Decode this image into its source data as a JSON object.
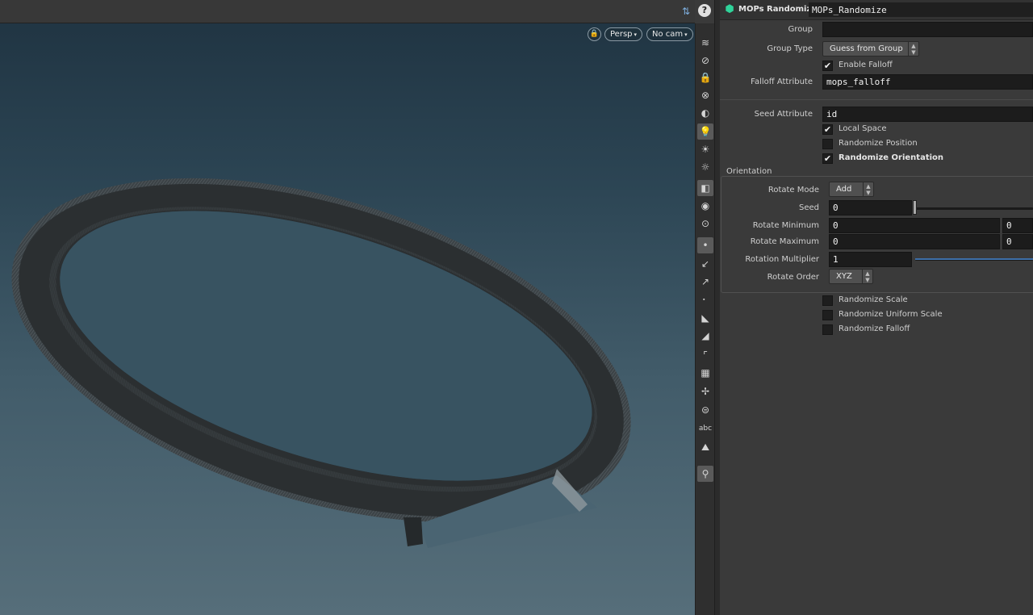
{
  "viewport": {
    "camera_view": "Persp",
    "camera": "No cam",
    "lock_icon": "lock-icon",
    "help_icon": "help-icon",
    "view_options_icon": "display-options-icon"
  },
  "toolbar": {
    "items": [
      {
        "name": "ghost-display-icon",
        "glyph": "≋",
        "on": false
      },
      {
        "name": "template-icon",
        "glyph": "⊘",
        "on": false
      },
      {
        "name": "lock-camera-icon",
        "glyph": "🔒",
        "on": false
      },
      {
        "name": "snap-off-icon",
        "glyph": "⊗",
        "on": false
      },
      {
        "name": "shading-icon",
        "glyph": "◐",
        "on": false
      },
      {
        "name": "light-icon",
        "glyph": "💡",
        "on": true
      },
      {
        "name": "light-bulb-small-icon",
        "glyph": "☀",
        "on": false
      },
      {
        "name": "light-bulb-alt-icon",
        "glyph": "☼",
        "on": false
      },
      {
        "name": "display-mode-icon",
        "glyph": "◧",
        "on": true
      },
      {
        "name": "visibility-icon",
        "glyph": "◉",
        "on": false
      },
      {
        "name": "camera-eye-icon",
        "glyph": "⊙",
        "on": false
      },
      {
        "name": "point-display-icon",
        "glyph": "•",
        "on": true
      },
      {
        "name": "normals-icon",
        "glyph": "↙",
        "on": false
      },
      {
        "name": "point-normals-icon",
        "glyph": "↗",
        "on": false
      },
      {
        "name": "point-numbers-icon",
        "glyph": "⠂",
        "on": false
      },
      {
        "name": "prim-normals-icon",
        "glyph": "◣",
        "on": false
      },
      {
        "name": "prim-numbers-icon",
        "glyph": "◢",
        "on": false
      },
      {
        "name": "edge-display-icon",
        "glyph": "⌜",
        "on": false
      },
      {
        "name": "uv-display-icon",
        "glyph": "▦",
        "on": false
      },
      {
        "name": "vector-display-icon",
        "glyph": "✢",
        "on": false
      },
      {
        "name": "hull-display-icon",
        "glyph": "⊜",
        "on": false
      },
      {
        "name": "text-display-icon",
        "glyph": "abc",
        "on": false
      },
      {
        "name": "background-image-icon",
        "glyph": "⛰",
        "on": false
      },
      {
        "name": "handle-display-icon",
        "glyph": "⚲",
        "on": true
      }
    ]
  },
  "node": {
    "icon": "mops-node-icon",
    "type_label": "MOPs Randomize",
    "name": "MOPs_Randomize"
  },
  "params": {
    "group_label": "Group",
    "group_value": "",
    "group_type_label": "Group Type",
    "group_type_value": "Guess from Group",
    "enable_falloff_label": "Enable Falloff",
    "enable_falloff_checked": true,
    "falloff_attr_label": "Falloff Attribute",
    "falloff_attr_value": "mops_falloff",
    "seed_attr_label": "Seed Attribute",
    "seed_attr_value": "id",
    "local_space_label": "Local Space",
    "local_space_checked": true,
    "randomize_position_label": "Randomize Position",
    "randomize_position_checked": false,
    "randomize_orientation_label": "Randomize Orientation",
    "randomize_orientation_checked": true,
    "orientation": {
      "title": "Orientation",
      "rotate_mode_label": "Rotate Mode",
      "rotate_mode_value": "Add",
      "seed_label": "Seed",
      "seed_value": "0",
      "rotate_min_label": "Rotate Minimum",
      "rotate_min_x": "0",
      "rotate_min_y": "0",
      "rotate_max_label": "Rotate Maximum",
      "rotate_max_x": "0",
      "rotate_max_y": "0",
      "rotation_multiplier_label": "Rotation Multiplier",
      "rotation_multiplier_value": "1",
      "rotate_order_label": "Rotate Order",
      "rotate_order_value": "XYZ"
    },
    "randomize_scale_label": "Randomize Scale",
    "randomize_scale_checked": false,
    "randomize_uniform_scale_label": "Randomize Uniform Scale",
    "randomize_uniform_scale_checked": false,
    "randomize_falloff_label": "Randomize Falloff",
    "randomize_falloff_checked": false
  }
}
